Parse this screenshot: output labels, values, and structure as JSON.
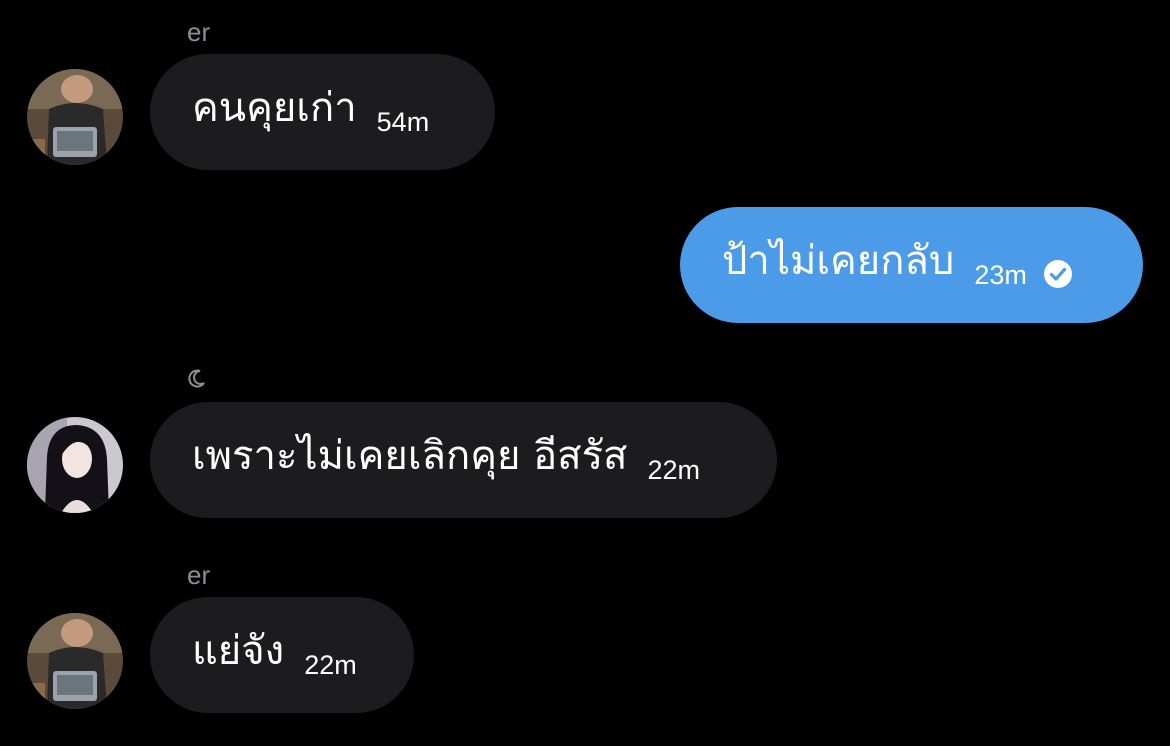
{
  "conversation": {
    "messages": [
      {
        "direction": "incoming",
        "sender": "er",
        "avatar_icon": "avatar-photo-man-laptop",
        "text": "คนคุยเก่า",
        "time": "54m"
      },
      {
        "direction": "outgoing",
        "text": "ป้าไม่เคยกลับ",
        "time": "23m",
        "status_icon": "read-check-icon"
      },
      {
        "direction": "incoming",
        "sender_status_icon": "moon-icon",
        "avatar_icon": "avatar-photo-woman",
        "text": "เพราะไม่เคยเลิกคุย อีสรัส",
        "time": "22m"
      },
      {
        "direction": "incoming",
        "sender": "er",
        "avatar_icon": "avatar-photo-man-laptop",
        "text": "แย่จัง",
        "time": "22m"
      }
    ]
  },
  "colors": {
    "background": "#000000",
    "incoming_bubble": "#1c1c1e",
    "outgoing_bubble": "#4c9be8",
    "sender_name": "#8e8e93"
  }
}
